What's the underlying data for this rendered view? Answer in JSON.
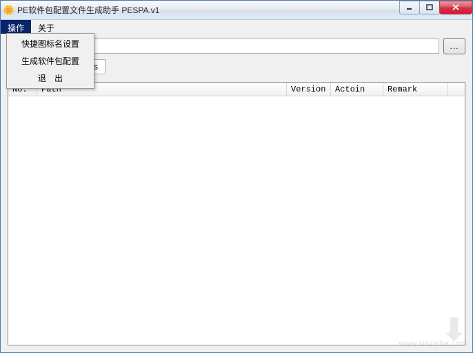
{
  "window": {
    "title": "PE软件包配置文件生成助手 PESPA.v1"
  },
  "menubar": {
    "items": [
      {
        "label": "操作",
        "active": true
      },
      {
        "label": "关于",
        "active": false
      }
    ]
  },
  "dropdown": {
    "items": [
      {
        "label": "快捷图标名设置"
      },
      {
        "label": "生成软件包配置"
      },
      {
        "label": "退　出"
      }
    ]
  },
  "inputs": {
    "path_value": "",
    "short_value": "s",
    "browse_label": "..."
  },
  "table": {
    "columns": {
      "no": "No.",
      "path": "Path",
      "version": "Version",
      "action": "Actoin",
      "remark": "Remark"
    },
    "rows": []
  },
  "watermark": {
    "text": "www.xiazaiba.com"
  }
}
